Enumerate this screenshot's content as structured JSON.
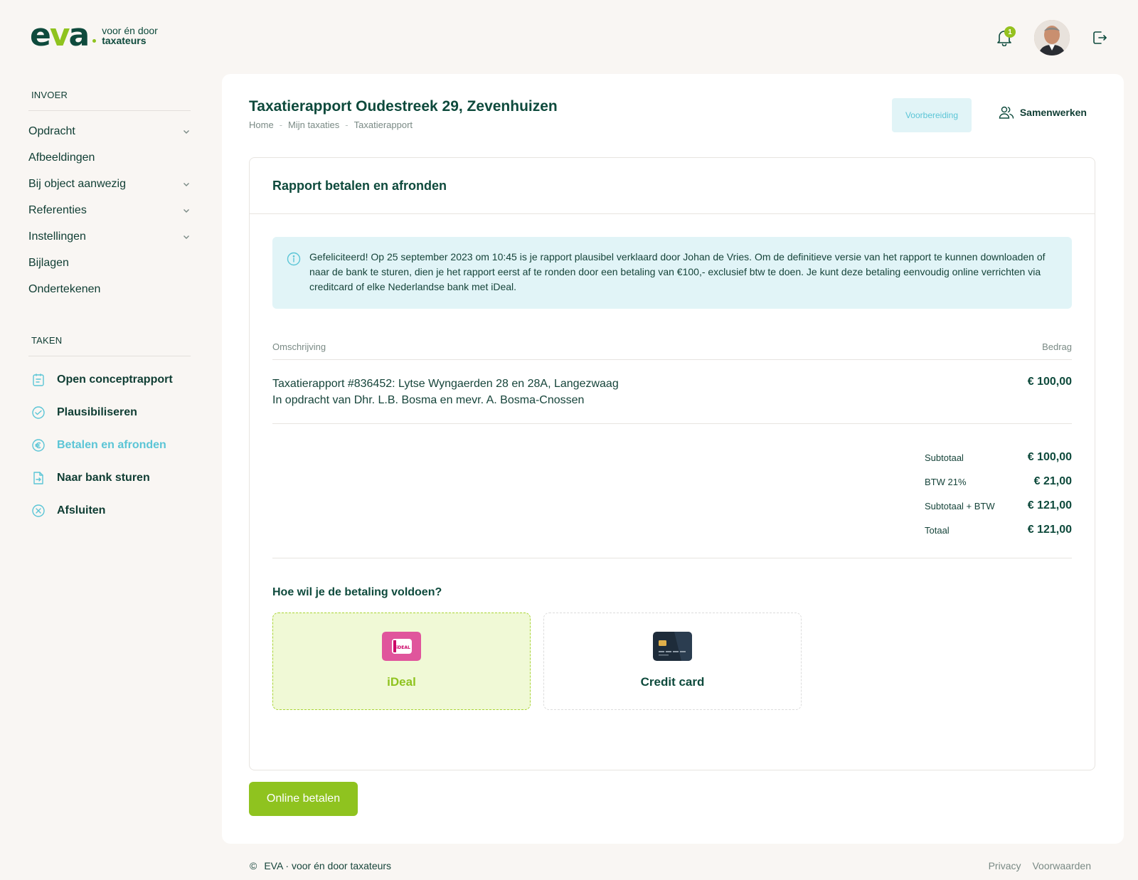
{
  "brand": {
    "logo_mark": "eva",
    "tagline_line1": "voor én door",
    "tagline_line2": "taxateurs"
  },
  "header": {
    "notification_count": "1"
  },
  "sidebar": {
    "invoer_title": "INVOER",
    "invoer_items": [
      {
        "label": "Opdracht",
        "expandable": true
      },
      {
        "label": "Afbeeldingen",
        "expandable": false
      },
      {
        "label": "Bij object aanwezig",
        "expandable": true
      },
      {
        "label": "Referenties",
        "expandable": true
      },
      {
        "label": "Instellingen",
        "expandable": true
      },
      {
        "label": "Bijlagen",
        "expandable": false
      },
      {
        "label": "Ondertekenen",
        "expandable": false
      }
    ],
    "taken_title": "TAKEN",
    "tasks": [
      {
        "label": "Open conceptrapport",
        "icon": "document-icon"
      },
      {
        "label": "Plausibiliseren",
        "icon": "check-circle-icon"
      },
      {
        "label": "Betalen en afronden",
        "icon": "euro-icon",
        "active": true
      },
      {
        "label": "Naar bank sturen",
        "icon": "send-file-icon"
      },
      {
        "label": "Afsluiten",
        "icon": "close-circle-icon"
      }
    ]
  },
  "main": {
    "title": "Taxatierapport Oudestreek 29, Zevenhuizen",
    "breadcrumb": [
      "Home",
      "Mijn taxaties",
      "Taxatierapport"
    ],
    "breadcrumb_sep": "-",
    "status": "Voorbereiding",
    "collab_label": "Samenwerken",
    "panel_title": "Rapport betalen en afronden",
    "info_text": "Gefeliciteerd! Op 25 september 2023 om 10:45 is je rapport plausibel verklaard door Johan de Vries. Om de definitieve versie van het rapport te kunnen downloaden of naar de bank te sturen, dien je het rapport eerst af te ronden door een betaling van €100,- exclusief btw te doen. Je kunt deze betaling eenvoudig online verrichten via creditcard of elke Nederlandse bank met iDeal.",
    "table": {
      "col_desc": "Omschrijving",
      "col_amount": "Bedrag",
      "row_line1": "Taxatierapport #836452: Lytse Wyngaerden 28 en 28A, Langezwaag",
      "row_line2": "In opdracht van Dhr. L.B. Bosma en mevr. A. Bosma-Cnossen",
      "row_amount": "€ 100,00"
    },
    "totals": [
      {
        "label": "Subtotaal",
        "value": "€ 100,00"
      },
      {
        "label": "BTW 21%",
        "value": "€ 21,00"
      },
      {
        "label": "Subtotaal + BTW",
        "value": "€ 121,00"
      },
      {
        "label": "Totaal",
        "value": "€ 121,00"
      }
    ],
    "pay_question": "Hoe wil je de betaling voldoen?",
    "pay_options": [
      {
        "label": "iDeal",
        "selected": true
      },
      {
        "label": "Credit card",
        "selected": false
      }
    ],
    "ideal_badge_text": "iDEAL",
    "pay_button": "Online betalen"
  },
  "footer": {
    "copyright_symbol": "©",
    "copyright_text": "EVA · voor én door taxateurs",
    "links": [
      "Privacy",
      "Voorwaarden"
    ]
  },
  "colors": {
    "brand_dark": "#0e4a3c",
    "brand_green": "#8fc31f",
    "accent_cyan": "#5bc5d6",
    "info_bg": "#e1f4f7"
  }
}
